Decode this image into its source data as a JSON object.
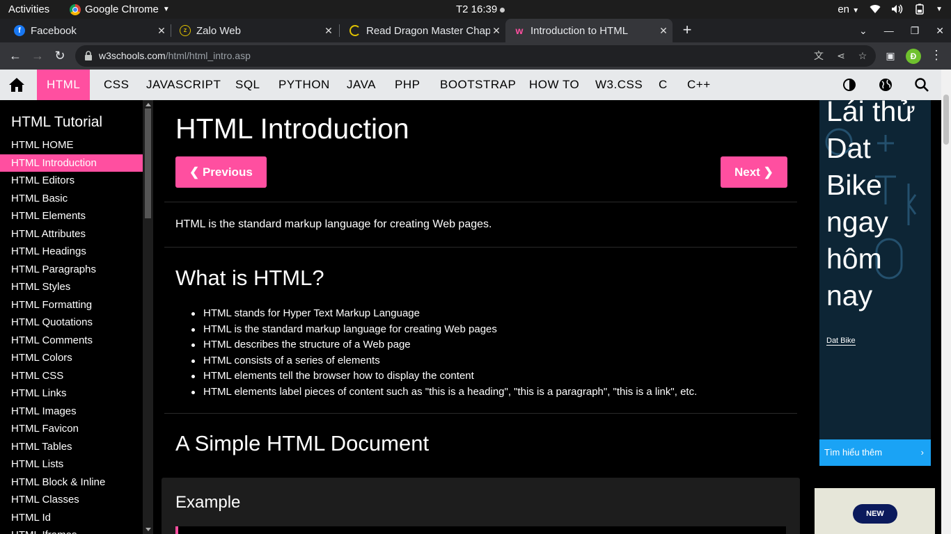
{
  "system_bar": {
    "activities": "Activities",
    "app_name": "Google Chrome",
    "clock": "T2 16:39",
    "language": "en"
  },
  "browser": {
    "tabs": [
      {
        "title": "Facebook",
        "favicon": "facebook-icon",
        "color": "#1877f2"
      },
      {
        "title": "Zalo Web",
        "favicon": "zalo-icon",
        "color": "#e0c200"
      },
      {
        "title": "Read Dragon Master Chap",
        "favicon": "loading-icon",
        "color": "#e0c200"
      },
      {
        "title": "Introduction to HTML",
        "favicon": "w3schools-icon",
        "color": "#ff4fa0"
      }
    ],
    "url_host": "w3schools.com",
    "url_path": "/html/html_intro.asp",
    "profile_initial": "Đ"
  },
  "w3nav": {
    "items": [
      "HTML",
      "CSS",
      "JAVASCRIPT",
      "SQL",
      "PYTHON",
      "JAVA",
      "PHP",
      "BOOTSTRAP",
      "HOW TO",
      "W3.CSS",
      "C",
      "C++"
    ],
    "active": "HTML",
    "accent": "#ff4fa0"
  },
  "sidebar": {
    "title": "HTML Tutorial",
    "items": [
      "HTML HOME",
      "HTML Introduction",
      "HTML Editors",
      "HTML Basic",
      "HTML Elements",
      "HTML Attributes",
      "HTML Headings",
      "HTML Paragraphs",
      "HTML Styles",
      "HTML Formatting",
      "HTML Quotations",
      "HTML Comments",
      "HTML Colors",
      "HTML CSS",
      "HTML Links",
      "HTML Images",
      "HTML Favicon",
      "HTML Tables",
      "HTML Lists",
      "HTML Block & Inline",
      "HTML Classes",
      "HTML Id",
      "HTML Iframes"
    ],
    "active_index": 1
  },
  "main": {
    "title": "HTML Introduction",
    "prev_label": "❮ Previous",
    "next_label": "Next ❯",
    "intro": "HTML is the standard markup language for creating Web pages.",
    "what_heading": "What is HTML?",
    "what_list": [
      "HTML stands for Hyper Text Markup Language",
      "HTML is the standard markup language for creating Web pages",
      "HTML describes the structure of a Web page",
      "HTML consists of a series of elements",
      "HTML elements tell the browser how to display the content",
      "HTML elements label pieces of content such as \"this is a heading\", \"this is a paragraph\", \"this is a link\", etc."
    ],
    "simple_heading": "A Simple HTML Document",
    "example_heading": "Example"
  },
  "ads": {
    "ad1_words": [
      "Lái thử",
      "Dat",
      "Bike",
      "ngay",
      "hôm",
      "nay"
    ],
    "ad1_brand": "Dat Bike",
    "ad1_cta": "Tìm hiểu thêm",
    "ad2_badge": "NEW"
  }
}
